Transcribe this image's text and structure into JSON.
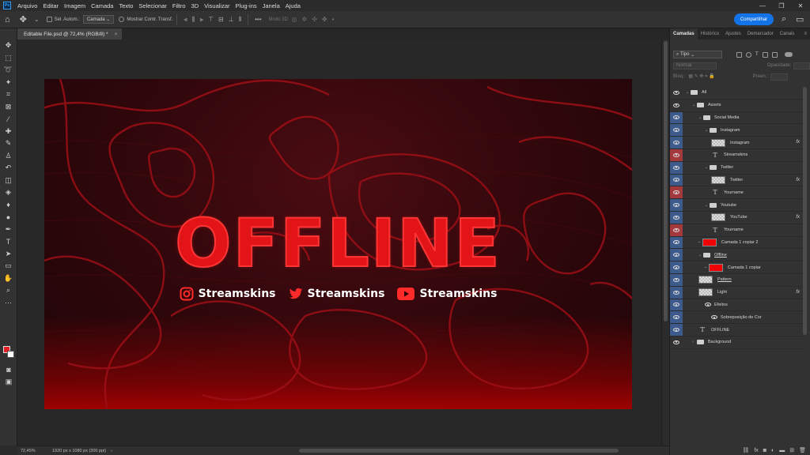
{
  "menubar": {
    "app_icon": "Ps",
    "items": [
      "Arquivo",
      "Editar",
      "Imagem",
      "Camada",
      "Texto",
      "Selecionar",
      "Filtro",
      "3D",
      "Visualizar",
      "Plug-ins",
      "Janela",
      "Ajuda"
    ],
    "window_controls": [
      "—",
      "❐",
      "✕"
    ]
  },
  "options": {
    "auto_select_label": "Sel. Autom.:",
    "auto_select_value": "Camada",
    "show_transform_label": "Mostrar Contr. Transf.",
    "mode_3d_label": "Modo 3D:",
    "share_label": "Compartilhar"
  },
  "document": {
    "tab_title": "Editable File.psd @ 72,4% (RGB/8) *",
    "tab_close": "×",
    "zoom": "72,45%",
    "info": "1920 px x 1080 px (300 ppi)",
    "info_chevron": "›"
  },
  "artwork": {
    "title": "OFFLINE",
    "social": [
      {
        "icon": "instagram-icon",
        "name": "Streamskins"
      },
      {
        "icon": "twitter-icon",
        "name": "Streamskins"
      },
      {
        "icon": "youtube-icon",
        "name": "Streamskins"
      }
    ]
  },
  "colors": {
    "foreground": "#e62020",
    "background": "#ffffff",
    "accent": "#1473e6",
    "title_red": "#e31418"
  },
  "layers_panel": {
    "tabs": [
      "Camadas",
      "Histórico",
      "Ajustes",
      "Demarcador",
      "Canais"
    ],
    "active_tab": "Camadas",
    "filter_value": "Tipo",
    "blend_mode": "Normal",
    "opacity_label": "Opacidade:",
    "lock_label": "Bloq.:",
    "fill_label": "Preen.:",
    "layers": [
      {
        "name": "All",
        "kind": "folder",
        "depth": 0,
        "eye": "none"
      },
      {
        "name": "Assets",
        "kind": "folder",
        "depth": 1,
        "eye": "none"
      },
      {
        "name": "Social Media",
        "kind": "folder",
        "depth": 2,
        "eye": "blue"
      },
      {
        "name": "Instagram",
        "kind": "folder",
        "depth": 3,
        "eye": "blue"
      },
      {
        "name": "Instagram",
        "kind": "smart",
        "depth": 4,
        "eye": "blue",
        "fx": "fx"
      },
      {
        "name": "Streamskins",
        "kind": "text",
        "depth": 4,
        "eye": "red"
      },
      {
        "name": "Twitter",
        "kind": "folder",
        "depth": 3,
        "eye": "blue"
      },
      {
        "name": "Twitter",
        "kind": "smart",
        "depth": 4,
        "eye": "blue",
        "fx": "fx"
      },
      {
        "name": "Yourname",
        "kind": "text",
        "depth": 4,
        "eye": "red"
      },
      {
        "name": "Youtube",
        "kind": "folder",
        "depth": 3,
        "eye": "blue"
      },
      {
        "name": "YouTube",
        "kind": "smart",
        "depth": 4,
        "eye": "blue",
        "fx": "fx"
      },
      {
        "name": "Yourname",
        "kind": "text",
        "depth": 4,
        "eye": "red"
      },
      {
        "name": "Camada 1 copiar 2",
        "kind": "red",
        "depth": 2,
        "eye": "blue"
      },
      {
        "name": "Offline",
        "kind": "folder",
        "depth": 2,
        "eye": "blue",
        "underline": true
      },
      {
        "name": "Camada 1 copiar",
        "kind": "red",
        "depth": 3,
        "eye": "blue"
      },
      {
        "name": "Pattern",
        "kind": "smart",
        "depth": 2,
        "eye": "blue",
        "underline": true
      },
      {
        "name": "Light",
        "kind": "smart",
        "depth": 2,
        "eye": "blue",
        "fx": "fx"
      },
      {
        "name": "Efeitos",
        "kind": "effect",
        "depth": 3,
        "eye": "blue"
      },
      {
        "name": "Sobreposição de Cor",
        "kind": "effect",
        "depth": 4,
        "eye": "blue"
      },
      {
        "name": "OFFLINE",
        "kind": "text",
        "depth": 2,
        "eye": "blue"
      },
      {
        "name": "Background",
        "kind": "folder-closed",
        "depth": 1,
        "eye": "plain"
      }
    ]
  }
}
